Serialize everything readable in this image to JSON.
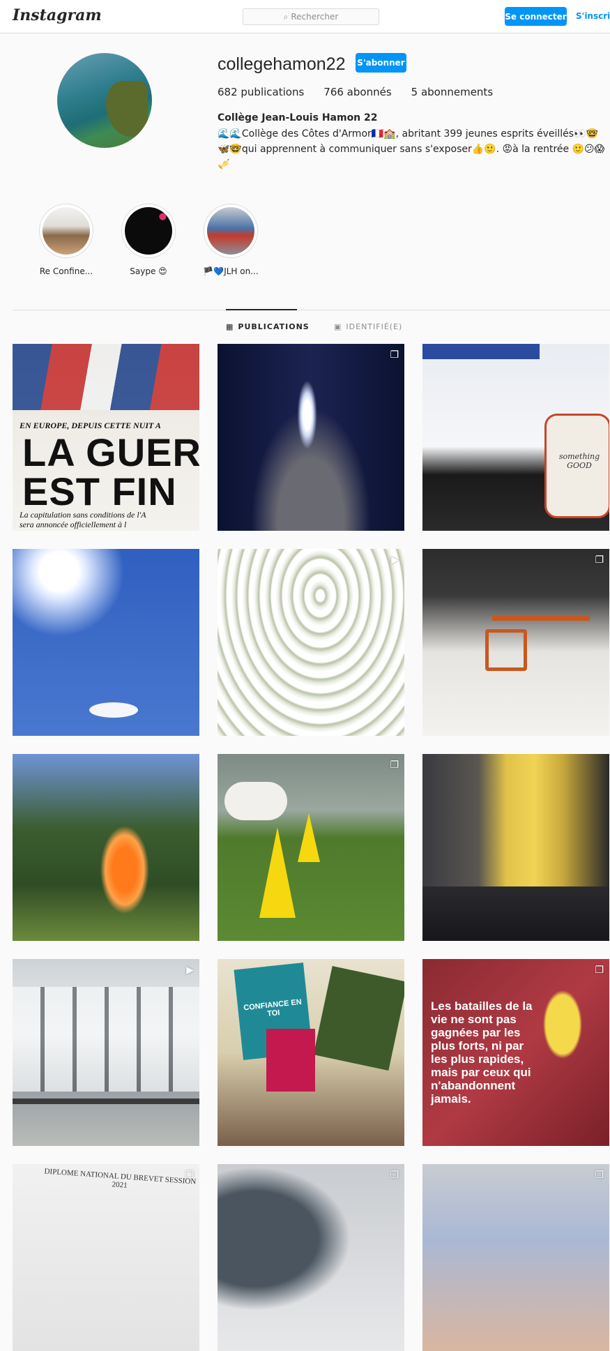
{
  "header": {
    "logo": "Instagram",
    "search_placeholder": "Rechercher",
    "login_label": "Se connecter",
    "signup_label": "S'inscrire"
  },
  "profile": {
    "username": "collegehamon22",
    "follow_label": "S'abonner",
    "stats": {
      "publications": "682 publications",
      "followers": "766 abonnés",
      "following": "5 abonnements"
    },
    "full_name": "Collège Jean-Louis Hamon 22",
    "bio": "🌊🌊Collège des Côtes d'Armor🇫🇷🏫, abritant 399 jeunes esprits éveillés👀🤓🦋🤓qui apprennent à communiquer sans s'exposer👍🙂. 😡à la rentrée 🙂😕😱🎺"
  },
  "highlights": [
    {
      "label": "Re Confine..."
    },
    {
      "label": "Saype 😍"
    },
    {
      "label": "🏴💙JLH on..."
    }
  ],
  "tabs": {
    "publications": "PUBLICATIONS",
    "tagged": "IDENTIFIÉ(E)"
  },
  "posts": {
    "newspaper": {
      "line1": "EN EUROPE, DEPUIS CETTE NUIT A",
      "line2a": "LA GUERR",
      "line2b": "EST FIN",
      "line3": "La capitulation sans conditions de l'A",
      "line4": "sera annoncée officiellement à l"
    },
    "mug_text": "something GOOD",
    "quote": "Les batailles de la vie ne sont pas gagnées par les plus forts, ni par les plus rapides, mais par ceux qui n'abandonnent jamais.",
    "diploma": "DIPLOME NATIONAL DU BREVET SESSION 2021",
    "book_text": "CONFIANCE EN TOI"
  },
  "colors": {
    "accent": "#0095f6",
    "border": "#dbdbdb",
    "background": "#fafafa"
  }
}
